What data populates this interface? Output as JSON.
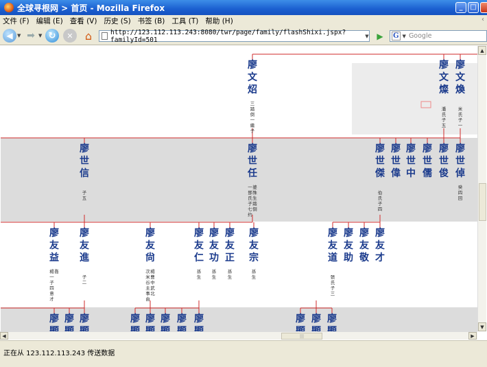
{
  "window": {
    "title": "全球寻根网 > 首页 - Mozilla Firefox",
    "controls": {
      "minimize": "_",
      "maximize": "□"
    }
  },
  "menu": [
    "文件 (F)",
    "编辑 (E)",
    "查看 (V)",
    "历史 (S)",
    "书签 (B)",
    "工具 (T)",
    "帮助 (H)"
  ],
  "menu_tail": "‹",
  "nav": {
    "url": "http://123.112.113.243:8080/twr/page/family/flashShixi.jspx?familyId=501",
    "search_placeholder": "Google",
    "search_engine_glyph": "G"
  },
  "colors": {
    "line": "#cf2a2a",
    "name": "#1a3a8c",
    "band": "#dcdcdc",
    "window_title": "#1b5fd0",
    "chrome": "#ece9d8"
  },
  "tree": {
    "gen1": [
      {
        "name": "廖文炤",
        "note": "三/踏/倒/一/繼/子"
      },
      {
        "name": "廖文燦",
        "note": "/潘/氏/子/五"
      },
      {
        "name": "廖文煥",
        "note": "/米/氏/子/一"
      }
    ],
    "gen2": [
      {
        "name": "廖世信",
        "note": "/子/五"
      },
      {
        "name": "廖世任",
        "note": "一/鄧/氏/子/七/约/婆/殊/生/踏/倒"
      },
      {
        "name": "廖世傑",
        "note": "/伯/氏/子/四"
      },
      {
        "name": "廖世偉",
        "note": ""
      },
      {
        "name": "廖世中",
        "note": ""
      },
      {
        "name": "廖世儒",
        "note": ""
      },
      {
        "name": "廖世俊",
        "note": ""
      },
      {
        "name": "廖世倬",
        "note": "癸/四/回"
      }
    ],
    "gen3": [
      {
        "name": "廖友益",
        "note": "楊/一/子/四/意/才/喬"
      },
      {
        "name": "廖友進",
        "note": "/子/二"
      },
      {
        "name": "廖友尙",
        "note": "次/米/谷/主/事/由/楊/曹/中/武/北"
      },
      {
        "name": "廖友仁",
        "note": "孫/生"
      },
      {
        "name": "廖友功",
        "note": "孫/生"
      },
      {
        "name": "廖友正",
        "note": "孫/生"
      },
      {
        "name": "廖友宗",
        "note": "孫/生"
      },
      {
        "name": "廖友道",
        "note": "/張/氏/子/三"
      },
      {
        "name": "廖友助",
        "note": ""
      },
      {
        "name": "廖友敬",
        "note": ""
      },
      {
        "name": "廖友才",
        "note": ""
      }
    ],
    "gen4": [
      {
        "name": "廖顯燊",
        "note": ""
      },
      {
        "name": "廖顯忠",
        "note": ""
      },
      {
        "name": "廖顯林",
        "note": ""
      },
      {
        "name": "廖顯森",
        "note": ""
      },
      {
        "name": "廖顯田",
        "note": ""
      },
      {
        "name": "廖顯謨",
        "note": ""
      },
      {
        "name": "廖顯先",
        "note": ""
      },
      {
        "name": "廖顯性",
        "note": ""
      },
      {
        "name": "廖顯鰲",
        "note": ""
      },
      {
        "name": "廖顯經",
        "note": ""
      },
      {
        "name": "廖顯政",
        "note": ""
      }
    ]
  },
  "status": "正在从 123.112.113.243 传送数据"
}
